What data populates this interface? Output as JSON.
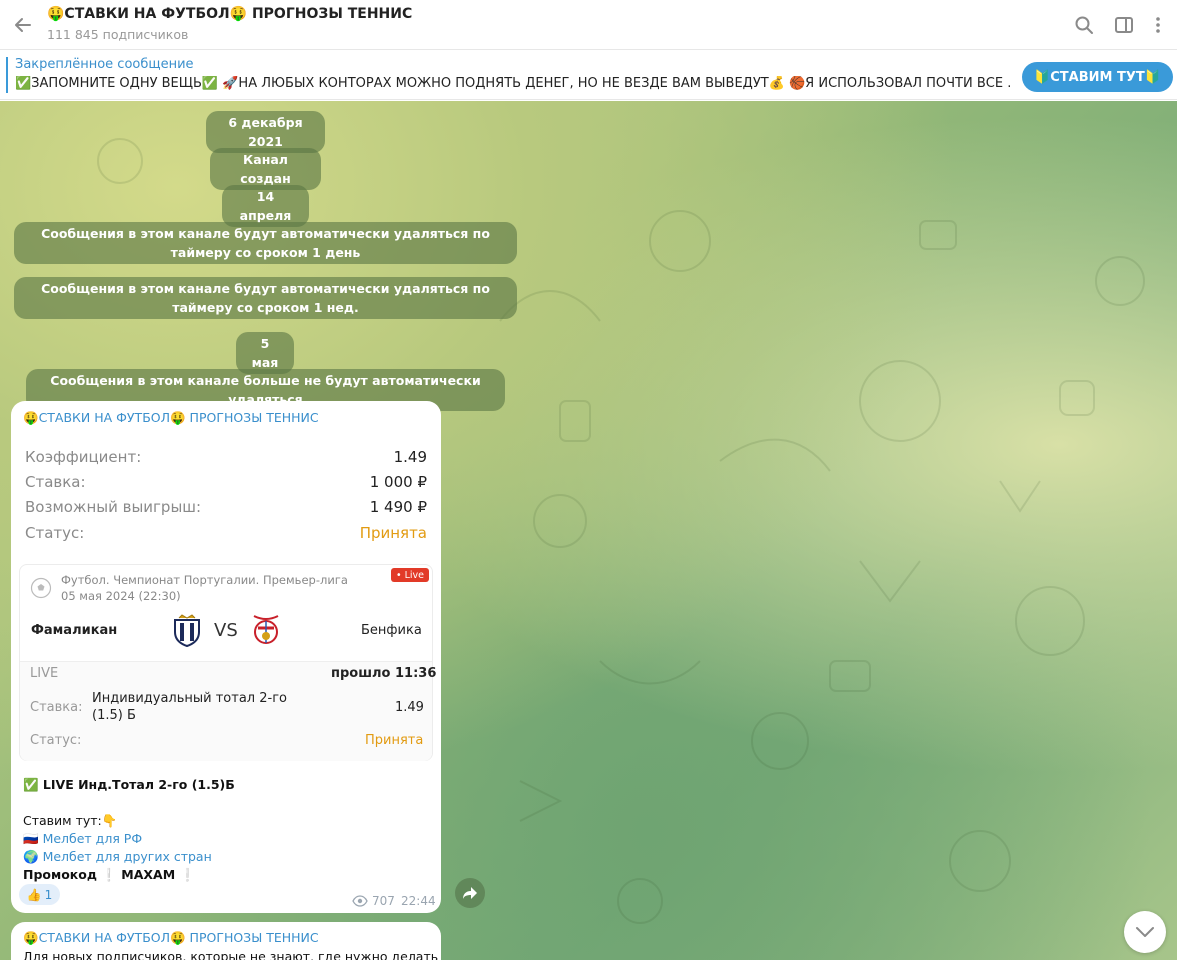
{
  "header": {
    "title": "🤑СТАВКИ НА ФУТБОЛ🤑 ПРОГНОЗЫ ТЕННИС",
    "subscribers": "111 845 подписчиков"
  },
  "pinned": {
    "label": "Закреплённое сообщение",
    "text": "✅ЗАПОМНИТЕ ОДНУ ВЕЩЬ✅   🚀НА ЛЮБЫХ КОНТОРАХ МОЖНО ПОДНЯТЬ ДЕНЕГ, НО НЕ ВЕЗДЕ ВАМ ВЫВЕДУТ💰   🏀Я ИСПОЛЬЗОВАЛ ПОЧТИ ВСЕ ...",
    "button_label": "🔰СТАВИМ ТУТ🔰"
  },
  "service_messages": [
    "6 декабря 2021",
    "Канал создан",
    "14 апреля",
    "Сообщения в этом канале будут автоматически удаляться по таймеру со сроком 1 день",
    "Сообщения в этом канале будут автоматически удаляться по таймеру со сроком 1 нед.",
    "5 мая",
    "Сообщения в этом канале больше не будут автоматически удаляться"
  ],
  "post": {
    "channel": "🤑СТАВКИ НА ФУТБОЛ🤑 ПРОГНОЗЫ ТЕННИС",
    "bet_rows": [
      {
        "label": "Коэффициент:",
        "value": "1.49"
      },
      {
        "label": "Ставка:",
        "value": "1 000 ₽"
      },
      {
        "label": "Возможный выигрыш:",
        "value": "1 490 ₽"
      },
      {
        "label": "Статус:",
        "value": "Принята"
      }
    ],
    "card": {
      "league": "Футбол. Чемпионат Португалии. Премьер-лига",
      "date": "05 мая 2024 (22:30)",
      "live_badge": "• Live",
      "home": "Фамаликан",
      "vs": "VS",
      "away": "Бенфика",
      "live_label": "LIVE",
      "elapsed": "прошло 11:36",
      "bet_label": "Ставка:",
      "bet_line1": "Индивидуальный тотал 2-го",
      "bet_line2": "(1.5) Б",
      "bet_odds": "1.49",
      "status_label": "Статус:",
      "status_value": "Принята"
    },
    "line1": "✅ LIVE Инд.Тотал 2-го (1.5)Б",
    "line2": "Ставим тут:👇",
    "link1_flag": "🇷🇺",
    "link1": "Мелбет для РФ",
    "link2_flag": "🌍",
    "link2": "Мелбет для других стран",
    "promo_label": "Промокод",
    "promo_code": "MAXAM",
    "reaction_emoji": "👍",
    "reaction_count": "1",
    "views": "707",
    "time": "22:44"
  },
  "post2": {
    "channel": "🤑СТАВКИ НА ФУТБОЛ🤑 ПРОГНОЗЫ ТЕННИС",
    "text": "Для новых подписчиков, которые не знают, где нужно делать"
  },
  "colors": {
    "accent": "#3a9ad9",
    "link": "#3a8fcc",
    "status_orange": "#e29b12",
    "live_red": "#e23a28"
  }
}
